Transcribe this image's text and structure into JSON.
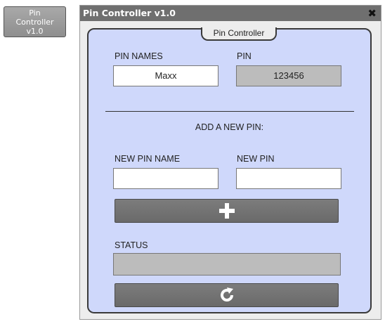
{
  "launcher": {
    "line1": "Pin",
    "line2": "Controller",
    "line3": "v1.0"
  },
  "window": {
    "title": "Pin Controller v1.0",
    "close_glyph": "✖"
  },
  "panel": {
    "tab_label": "Pin Controller",
    "pin_names_label": "PIN NAMES",
    "pin_label": "PIN",
    "pin_name_value": "Maxx",
    "pin_value": "123456",
    "divider_text": "_______________________________________________",
    "add_title": "ADD A NEW PIN:",
    "new_pin_name_label": "NEW PIN NAME",
    "new_pin_label": "NEW PIN",
    "new_pin_name_value": "",
    "new_pin_value": "",
    "status_label": "STATUS",
    "status_value": ""
  },
  "icons": {
    "add": "plus-icon",
    "refresh": "refresh-icon",
    "close": "close-icon"
  },
  "colors": {
    "panel_bg": "#cfd8fb",
    "titlebar": "#6f6f6f",
    "button": "#6f6f6f",
    "readonly_field": "#bcbcbc"
  }
}
